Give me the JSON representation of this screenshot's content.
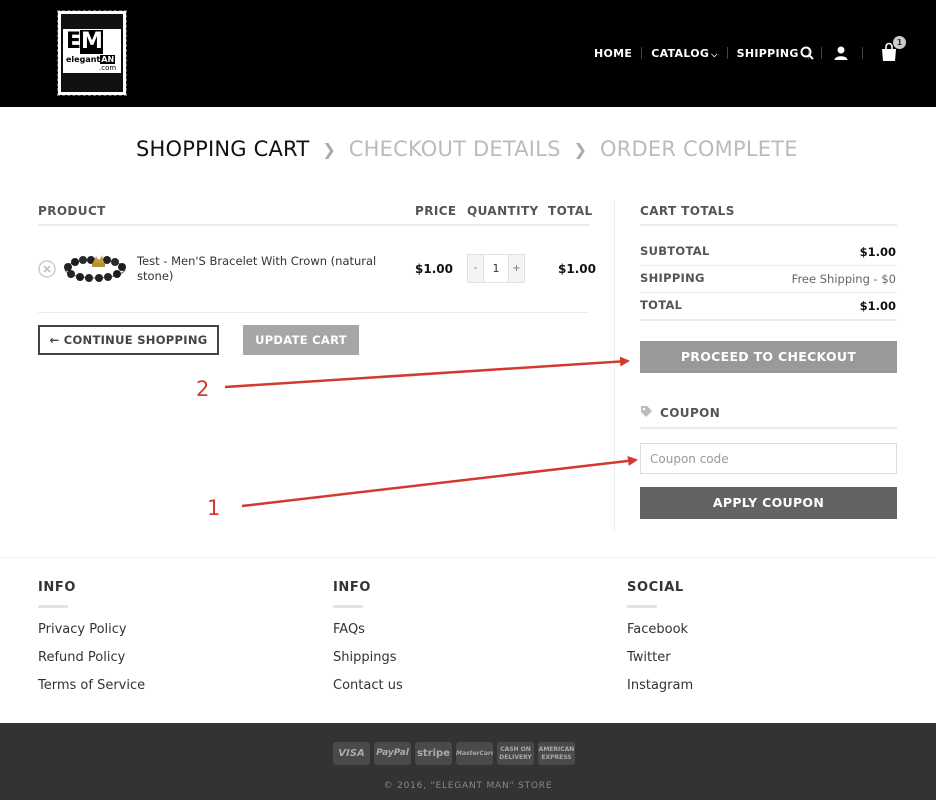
{
  "header": {
    "logo": {
      "big": "EM",
      "small_left": "elegant",
      "small_right": "AN",
      "small_com": ".com"
    },
    "nav": [
      "HOME",
      "CATALOG",
      "SHIPPING"
    ],
    "cart_count": "1"
  },
  "breadcrumb": {
    "steps": [
      "SHOPPING CART",
      "CHECKOUT DETAILS",
      "ORDER COMPLETE"
    ]
  },
  "cart": {
    "headers": {
      "product": "PRODUCT",
      "price": "PRICE",
      "quantity": "QUANTITY",
      "total": "TOTAL"
    },
    "items": [
      {
        "name": "Test - Men'S Bracelet With Crown (natural stone)",
        "price": "$1.00",
        "quantity": "1",
        "total": "$1.00"
      }
    ],
    "qty_minus": "-",
    "qty_plus": "+",
    "continue_label": "← CONTINUE SHOPPING",
    "update_label": "UPDATE CART"
  },
  "totals": {
    "title": "CART TOTALS",
    "rows": [
      {
        "label": "SUBTOTAL",
        "value": "$1.00"
      },
      {
        "label": "SHIPPING",
        "value": "Free Shipping - $0"
      },
      {
        "label": "TOTAL",
        "value": "$1.00"
      }
    ],
    "checkout_label": "PROCEED TO CHECKOUT"
  },
  "coupon": {
    "title": "COUPON",
    "placeholder": "Coupon code",
    "apply_label": "APPLY COUPON"
  },
  "annotations": {
    "one": "1",
    "two": "2",
    "color": "#d33a2f"
  },
  "footer": {
    "columns": [
      {
        "title": "INFO",
        "links": [
          "Privacy Policy",
          "Refund Policy",
          "Terms of Service"
        ]
      },
      {
        "title": "INFO",
        "links": [
          "FAQs",
          "Shippings",
          "Contact us"
        ]
      },
      {
        "title": "SOCIAL",
        "links": [
          "Facebook",
          "Twitter",
          "Instagram"
        ]
      }
    ],
    "payments": [
      "VISA",
      "PayPal",
      "stripe",
      "MasterCard",
      "CASH ON DELIVERY",
      "AMERICAN EXPRESS"
    ],
    "copyright": "© 2016, \"ELEGANT MAN\" STORE"
  },
  "colors": {
    "header_bg": "#000000",
    "checkout_btn": "#999999",
    "apply_btn": "#636363",
    "bottom_bar": "#333333"
  }
}
